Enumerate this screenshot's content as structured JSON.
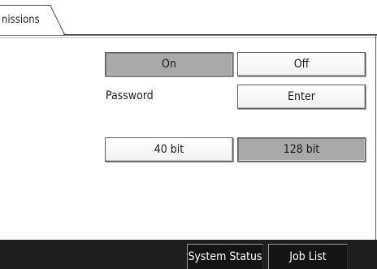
{
  "tab": {
    "label": "nissions"
  },
  "encryption": {
    "on_label": "On",
    "off_label": "Off",
    "selected": "On"
  },
  "password": {
    "label": "Password",
    "enter_label": "Enter"
  },
  "bit_strength": {
    "option_40": "40 bit",
    "option_128": "128 bit",
    "selected": "128 bit"
  },
  "bottom_bar": {
    "system_status_label": "System Status",
    "job_list_label": "Job List"
  }
}
